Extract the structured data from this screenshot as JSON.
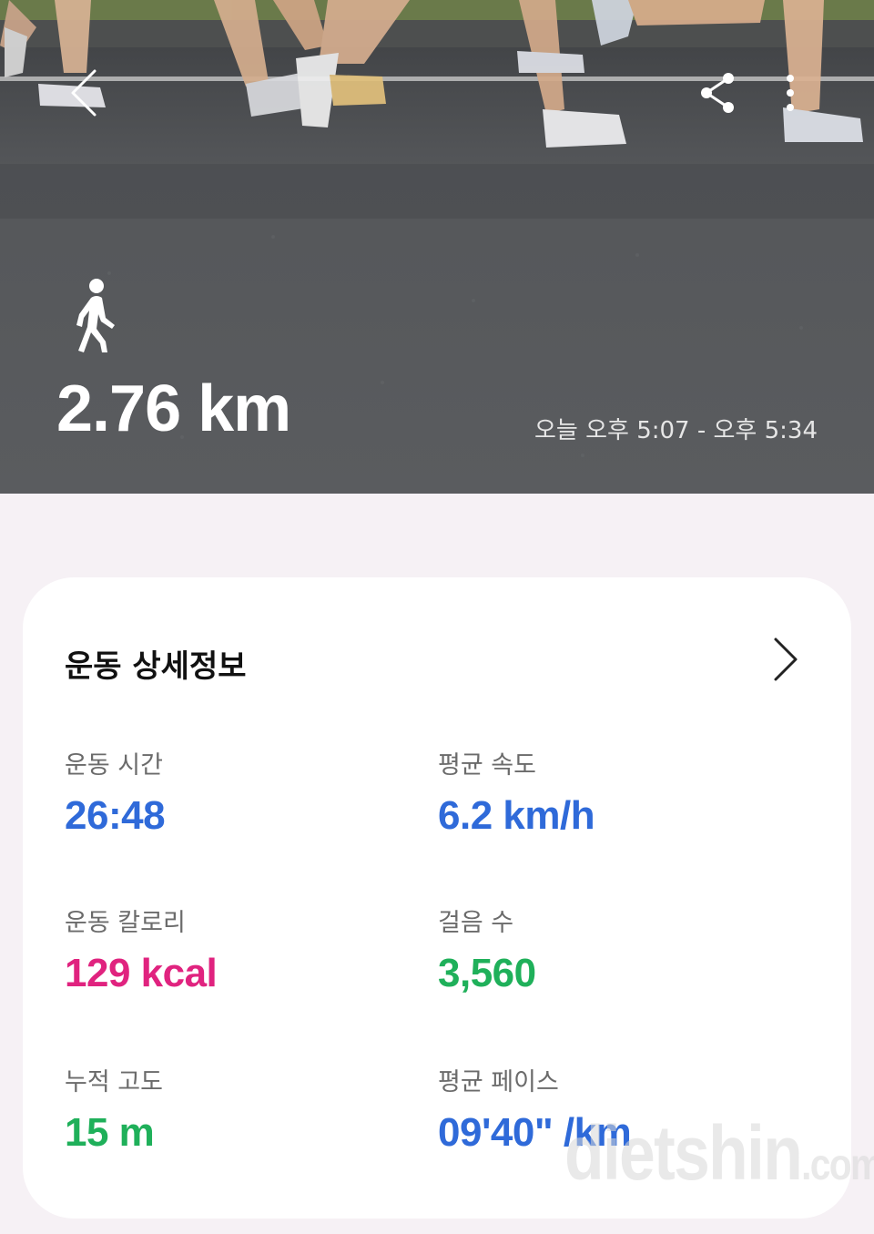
{
  "colors": {
    "blue": "#2f6ad9",
    "pink": "#e0237f",
    "green": "#1fb05a"
  },
  "header": {
    "back_icon": "back-arrow-icon",
    "share_icon": "share-icon",
    "more_icon": "more-vertical-icon",
    "activity_icon": "walking-person-icon",
    "distance": "2.76 km",
    "time_range": "오늘 오후 5:07 - 오후 5:34"
  },
  "details": {
    "title": "운동 상세정보",
    "chevron_icon": "chevron-right-icon",
    "stats": [
      {
        "label": "운동 시간",
        "value": "26:48",
        "color": "blue"
      },
      {
        "label": "평균 속도",
        "value": "6.2 km/h",
        "color": "blue"
      },
      {
        "label": "운동 칼로리",
        "value": "129 kcal",
        "color": "pink"
      },
      {
        "label": "걸음 수",
        "value": "3,560",
        "color": "green"
      },
      {
        "label": "누적 고도",
        "value": "15 m",
        "color": "green"
      },
      {
        "label": "평균 페이스",
        "value": "09'40\" /km",
        "color": "blue"
      }
    ]
  },
  "watermark": {
    "brand": "dietshin",
    "suffix": ".com"
  }
}
